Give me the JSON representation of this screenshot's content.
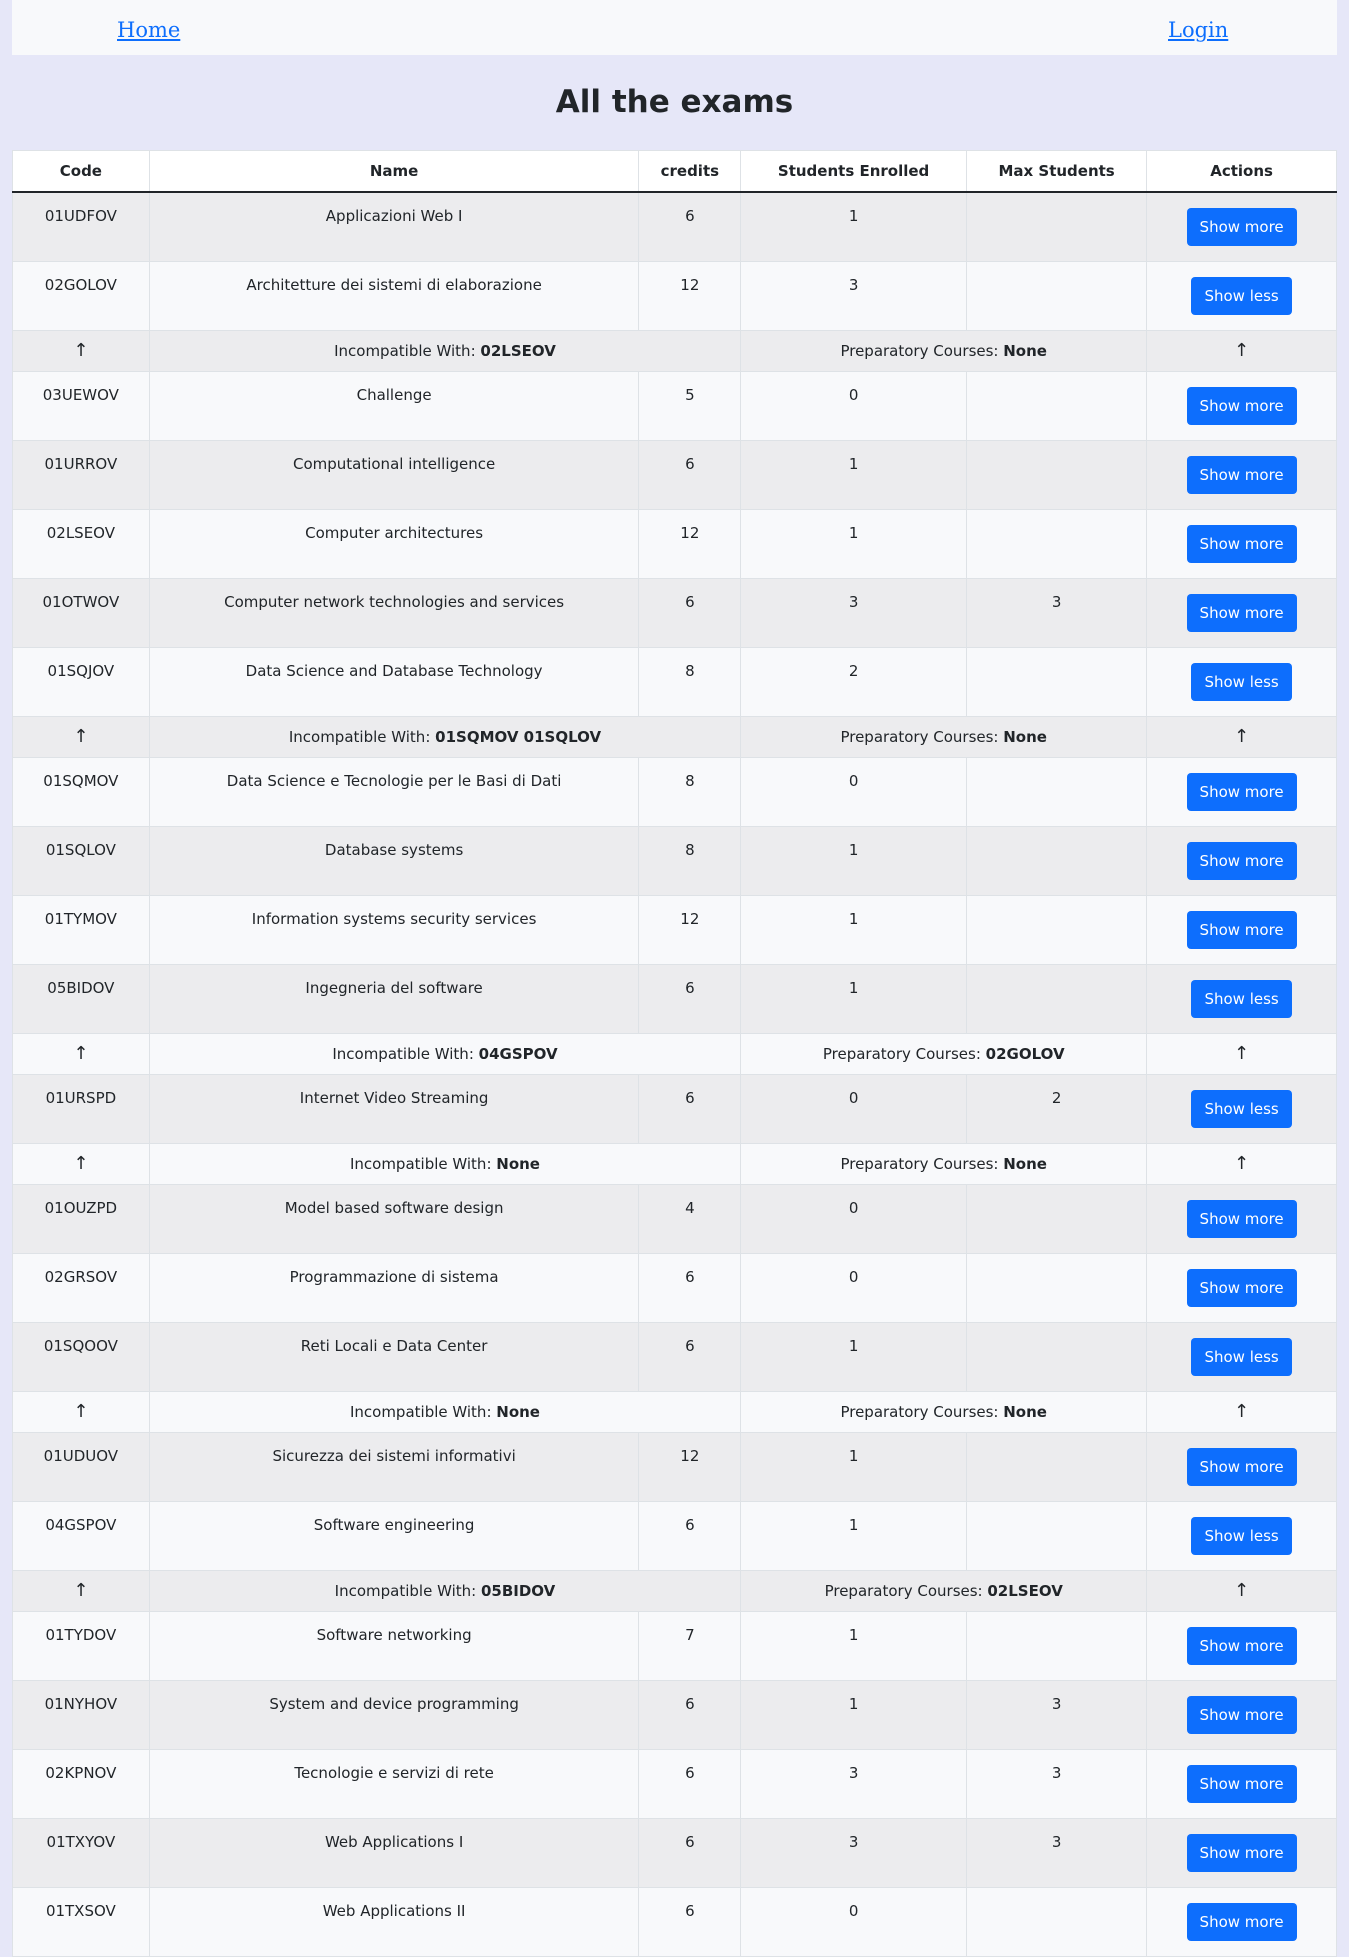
{
  "nav": {
    "home": "Home",
    "login": "Login"
  },
  "title": "All the exams",
  "columns": [
    "Code",
    "Name",
    "credits",
    "Students Enrolled",
    "Max Students",
    "Actions"
  ],
  "detail_labels": {
    "incompatible": "Incompatible With: ",
    "preparatory": "Preparatory Courses: ",
    "arrow": "↑"
  },
  "button_labels": {
    "more": "Show more",
    "less": "Show less"
  },
  "rows": [
    {
      "type": "exam",
      "code": "01UDFOV",
      "name": "Applicazioni Web I",
      "credits": "6",
      "enrolled": "1",
      "max": "",
      "action": "Show more"
    },
    {
      "type": "exam",
      "code": "02GOLOV",
      "name": "Architetture dei sistemi di elaborazione",
      "credits": "12",
      "enrolled": "3",
      "max": "",
      "action": "Show less"
    },
    {
      "type": "detail",
      "incompatible": "02LSEOV",
      "preparatory": "None"
    },
    {
      "type": "exam",
      "code": "03UEWOV",
      "name": "Challenge",
      "credits": "5",
      "enrolled": "0",
      "max": "",
      "action": "Show more"
    },
    {
      "type": "exam",
      "code": "01URROV",
      "name": "Computational intelligence",
      "credits": "6",
      "enrolled": "1",
      "max": "",
      "action": "Show more"
    },
    {
      "type": "exam",
      "code": "02LSEOV",
      "name": "Computer architectures",
      "credits": "12",
      "enrolled": "1",
      "max": "",
      "action": "Show more"
    },
    {
      "type": "exam",
      "code": "01OTWOV",
      "name": "Computer network technologies and services",
      "credits": "6",
      "enrolled": "3",
      "max": "3",
      "action": "Show more"
    },
    {
      "type": "exam",
      "code": "01SQJOV",
      "name": "Data Science and Database Technology",
      "credits": "8",
      "enrolled": "2",
      "max": "",
      "action": "Show less"
    },
    {
      "type": "detail",
      "incompatible": "01SQMOV 01SQLOV",
      "preparatory": "None"
    },
    {
      "type": "exam",
      "code": "01SQMOV",
      "name": "Data Science e Tecnologie per le Basi di Dati",
      "credits": "8",
      "enrolled": "0",
      "max": "",
      "action": "Show more"
    },
    {
      "type": "exam",
      "code": "01SQLOV",
      "name": "Database systems",
      "credits": "8",
      "enrolled": "1",
      "max": "",
      "action": "Show more"
    },
    {
      "type": "exam",
      "code": "01TYMOV",
      "name": "Information systems security services",
      "credits": "12",
      "enrolled": "1",
      "max": "",
      "action": "Show more"
    },
    {
      "type": "exam",
      "code": "05BIDOV",
      "name": "Ingegneria del software",
      "credits": "6",
      "enrolled": "1",
      "max": "",
      "action": "Show less"
    },
    {
      "type": "detail",
      "incompatible": "04GSPOV",
      "preparatory": "02GOLOV"
    },
    {
      "type": "exam",
      "code": "01URSPD",
      "name": "Internet Video Streaming",
      "credits": "6",
      "enrolled": "0",
      "max": "2",
      "action": "Show less"
    },
    {
      "type": "detail",
      "incompatible": "None",
      "preparatory": "None"
    },
    {
      "type": "exam",
      "code": "01OUZPD",
      "name": "Model based software design",
      "credits": "4",
      "enrolled": "0",
      "max": "",
      "action": "Show more"
    },
    {
      "type": "exam",
      "code": "02GRSOV",
      "name": "Programmazione di sistema",
      "credits": "6",
      "enrolled": "0",
      "max": "",
      "action": "Show more"
    },
    {
      "type": "exam",
      "code": "01SQOOV",
      "name": "Reti Locali e Data Center",
      "credits": "6",
      "enrolled": "1",
      "max": "",
      "action": "Show less"
    },
    {
      "type": "detail",
      "incompatible": "None",
      "preparatory": "None"
    },
    {
      "type": "exam",
      "code": "01UDUOV",
      "name": "Sicurezza dei sistemi informativi",
      "credits": "12",
      "enrolled": "1",
      "max": "",
      "action": "Show more"
    },
    {
      "type": "exam",
      "code": "04GSPOV",
      "name": "Software engineering",
      "credits": "6",
      "enrolled": "1",
      "max": "",
      "action": "Show less"
    },
    {
      "type": "detail",
      "incompatible": "05BIDOV",
      "preparatory": "02LSEOV"
    },
    {
      "type": "exam",
      "code": "01TYDOV",
      "name": "Software networking",
      "credits": "7",
      "enrolled": "1",
      "max": "",
      "action": "Show more"
    },
    {
      "type": "exam",
      "code": "01NYHOV",
      "name": "System and device programming",
      "credits": "6",
      "enrolled": "1",
      "max": "3",
      "action": "Show more"
    },
    {
      "type": "exam",
      "code": "02KPNOV",
      "name": "Tecnologie e servizi di rete",
      "credits": "6",
      "enrolled": "3",
      "max": "3",
      "action": "Show more"
    },
    {
      "type": "exam",
      "code": "01TXYOV",
      "name": "Web Applications I",
      "credits": "6",
      "enrolled": "3",
      "max": "3",
      "action": "Show more"
    },
    {
      "type": "exam",
      "code": "01TXSOV",
      "name": "Web Applications II",
      "credits": "6",
      "enrolled": "0",
      "max": "",
      "action": "Show more"
    }
  ]
}
